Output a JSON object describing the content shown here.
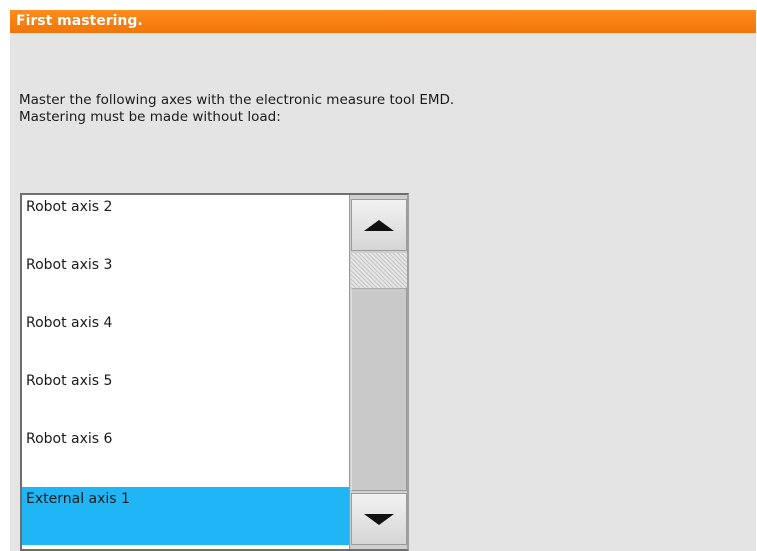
{
  "dialog": {
    "title": "First mastering.",
    "message_line1": "Master the following axes with the electronic measure tool EMD.",
    "message_line2": "Mastering must be made without load:"
  },
  "axis_list": {
    "items": [
      {
        "label": "Robot axis 2",
        "selected": false
      },
      {
        "label": "Robot axis 3",
        "selected": false
      },
      {
        "label": "Robot axis 4",
        "selected": false
      },
      {
        "label": "Robot axis 5",
        "selected": false
      },
      {
        "label": "Robot axis 6",
        "selected": false
      },
      {
        "label": "External axis 1",
        "selected": true
      }
    ]
  },
  "scrollbar": {
    "up_icon": "triangle-up-icon",
    "down_icon": "triangle-down-icon"
  },
  "colors": {
    "title_bar": "#f07a0e",
    "selection": "#20b6f6",
    "panel_bg": "#e4e4e4"
  }
}
